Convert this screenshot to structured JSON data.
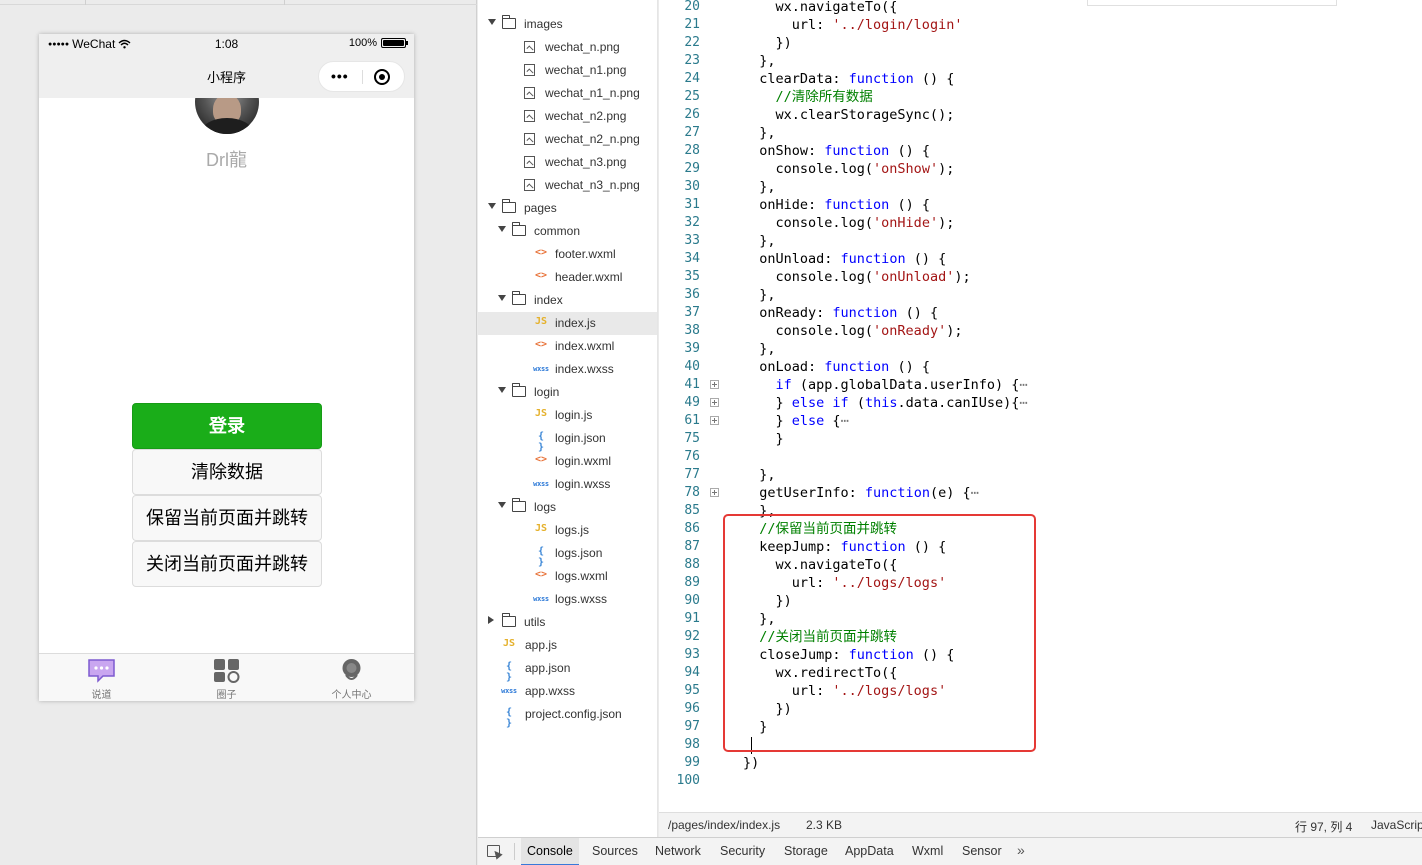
{
  "simulator": {
    "status_bar": {
      "carrier": "WeChat",
      "signal": "●●●●●",
      "time": "1:08",
      "battery": "100%"
    },
    "nav_bar": {
      "title": "小程序",
      "more": "•••"
    },
    "nickname": "Drl龍",
    "buttons": {
      "login": "登录",
      "clear": "清除数据",
      "keep_jump": "保留当前页面并跳转",
      "close_jump": "关闭当前页面并跳转"
    },
    "tabs": [
      {
        "label": "说道",
        "icon": "chat-icon",
        "color": "#1aad19"
      },
      {
        "label": "圈子",
        "icon": "circle-icon",
        "color": "#777777"
      },
      {
        "label": "个人中心",
        "icon": "profile-icon",
        "color": "#777777"
      }
    ]
  },
  "file_tree": {
    "items": [
      {
        "label": "images",
        "type": "folder",
        "expanded": true
      },
      {
        "label": "wechat_n.png",
        "type": "image"
      },
      {
        "label": "wechat_n1.png",
        "type": "image"
      },
      {
        "label": "wechat_n1_n.png",
        "type": "image"
      },
      {
        "label": "wechat_n2.png",
        "type": "image"
      },
      {
        "label": "wechat_n2_n.png",
        "type": "image"
      },
      {
        "label": "wechat_n3.png",
        "type": "image"
      },
      {
        "label": "wechat_n3_n.png",
        "type": "image"
      },
      {
        "label": "pages",
        "type": "folder",
        "expanded": true
      },
      {
        "label": "common",
        "type": "folder",
        "expanded": true
      },
      {
        "label": "footer.wxml",
        "type": "wxml"
      },
      {
        "label": "header.wxml",
        "type": "wxml"
      },
      {
        "label": "index",
        "type": "folder",
        "expanded": true
      },
      {
        "label": "index.js",
        "type": "js",
        "selected": true
      },
      {
        "label": "index.wxml",
        "type": "wxml"
      },
      {
        "label": "index.wxss",
        "type": "wxss"
      },
      {
        "label": "login",
        "type": "folder",
        "expanded": true
      },
      {
        "label": "login.js",
        "type": "js"
      },
      {
        "label": "login.json",
        "type": "json"
      },
      {
        "label": "login.wxml",
        "type": "wxml"
      },
      {
        "label": "login.wxss",
        "type": "wxss"
      },
      {
        "label": "logs",
        "type": "folder",
        "expanded": true
      },
      {
        "label": "logs.js",
        "type": "js"
      },
      {
        "label": "logs.json",
        "type": "json"
      },
      {
        "label": "logs.wxml",
        "type": "wxml"
      },
      {
        "label": "logs.wxss",
        "type": "wxss"
      },
      {
        "label": "utils",
        "type": "folder",
        "expanded": false
      },
      {
        "label": "app.js",
        "type": "js"
      },
      {
        "label": "app.json",
        "type": "json"
      },
      {
        "label": "app.wxss",
        "type": "wxss"
      },
      {
        "label": "project.config.json",
        "type": "json"
      }
    ],
    "icon_glyphs": {
      "js": "JS",
      "wxml": "<>",
      "json": "{ }",
      "wxss": "wxss"
    }
  },
  "editor": {
    "lines": [
      {
        "n": "20",
        "tokens": [
          [
            "    wx.navigateTo({",
            ""
          ]
        ]
      },
      {
        "n": "21",
        "tokens": [
          [
            "      url: ",
            ""
          ],
          [
            "'../login/login'",
            "str"
          ]
        ]
      },
      {
        "n": "22",
        "tokens": [
          [
            "    })",
            ""
          ]
        ]
      },
      {
        "n": "23",
        "tokens": [
          [
            "  },",
            ""
          ]
        ]
      },
      {
        "n": "24",
        "tokens": [
          [
            "  clearData: ",
            ""
          ],
          [
            "function",
            "kw"
          ],
          [
            " () {",
            ""
          ]
        ]
      },
      {
        "n": "25",
        "tokens": [
          [
            "    ",
            ""
          ],
          [
            "//清除所有数据",
            "cmt"
          ]
        ]
      },
      {
        "n": "26",
        "tokens": [
          [
            "    wx.clearStorageSync();",
            ""
          ]
        ]
      },
      {
        "n": "27",
        "tokens": [
          [
            "  },",
            ""
          ]
        ]
      },
      {
        "n": "28",
        "tokens": [
          [
            "  onShow: ",
            ""
          ],
          [
            "function",
            "kw"
          ],
          [
            " () {",
            ""
          ]
        ]
      },
      {
        "n": "29",
        "tokens": [
          [
            "    console.log(",
            ""
          ],
          [
            "'onShow'",
            "str"
          ],
          [
            ");",
            ""
          ]
        ]
      },
      {
        "n": "30",
        "tokens": [
          [
            "  },",
            ""
          ]
        ]
      },
      {
        "n": "31",
        "tokens": [
          [
            "  onHide: ",
            ""
          ],
          [
            "function",
            "kw"
          ],
          [
            " () {",
            ""
          ]
        ]
      },
      {
        "n": "32",
        "tokens": [
          [
            "    console.log(",
            ""
          ],
          [
            "'onHide'",
            "str"
          ],
          [
            ");",
            ""
          ]
        ]
      },
      {
        "n": "33",
        "tokens": [
          [
            "  },",
            ""
          ]
        ]
      },
      {
        "n": "34",
        "tokens": [
          [
            "  onUnload: ",
            ""
          ],
          [
            "function",
            "kw"
          ],
          [
            " () {",
            ""
          ]
        ]
      },
      {
        "n": "35",
        "tokens": [
          [
            "    console.log(",
            ""
          ],
          [
            "'onUnload'",
            "str"
          ],
          [
            ");",
            ""
          ]
        ]
      },
      {
        "n": "36",
        "tokens": [
          [
            "  },",
            ""
          ]
        ]
      },
      {
        "n": "37",
        "tokens": [
          [
            "  onReady: ",
            ""
          ],
          [
            "function",
            "kw"
          ],
          [
            " () {",
            ""
          ]
        ]
      },
      {
        "n": "38",
        "tokens": [
          [
            "    console.log(",
            ""
          ],
          [
            "'onReady'",
            "str"
          ],
          [
            ");",
            ""
          ]
        ]
      },
      {
        "n": "39",
        "tokens": [
          [
            "  },",
            ""
          ]
        ]
      },
      {
        "n": "40",
        "tokens": [
          [
            "  onLoad: ",
            ""
          ],
          [
            "function",
            "kw"
          ],
          [
            " () {",
            ""
          ]
        ]
      },
      {
        "n": "41",
        "fold": true,
        "tokens": [
          [
            "    ",
            ""
          ],
          [
            "if",
            "kw"
          ],
          [
            " (app.globalData.userInfo) {",
            ""
          ],
          [
            "⋯",
            "dim"
          ]
        ]
      },
      {
        "n": "49",
        "fold": true,
        "tokens": [
          [
            "    } ",
            ""
          ],
          [
            "else if",
            "kw"
          ],
          [
            " (",
            ""
          ],
          [
            "this",
            "kw"
          ],
          [
            ".data.canIUse){",
            ""
          ],
          [
            "⋯",
            "dim"
          ]
        ]
      },
      {
        "n": "61",
        "fold": true,
        "tokens": [
          [
            "    } ",
            ""
          ],
          [
            "else",
            "kw"
          ],
          [
            " {",
            ""
          ],
          [
            "⋯",
            "dim"
          ]
        ]
      },
      {
        "n": "75",
        "tokens": [
          [
            "    }",
            ""
          ]
        ]
      },
      {
        "n": "76",
        "tokens": [
          [
            "",
            ""
          ]
        ]
      },
      {
        "n": "77",
        "tokens": [
          [
            "  },",
            ""
          ]
        ]
      },
      {
        "n": "78",
        "fold": true,
        "tokens": [
          [
            "  getUserInfo: ",
            ""
          ],
          [
            "function",
            "kw"
          ],
          [
            "(e) {",
            ""
          ],
          [
            "⋯",
            "dim"
          ]
        ]
      },
      {
        "n": "85",
        "tokens": [
          [
            "  },",
            ""
          ]
        ]
      },
      {
        "n": "86",
        "tokens": [
          [
            "  ",
            ""
          ],
          [
            "//保留当前页面并跳转",
            "cmt"
          ]
        ]
      },
      {
        "n": "87",
        "tokens": [
          [
            "  keepJump: ",
            ""
          ],
          [
            "function",
            "kw"
          ],
          [
            " () {",
            ""
          ]
        ]
      },
      {
        "n": "88",
        "tokens": [
          [
            "    wx.navigateTo({",
            ""
          ]
        ]
      },
      {
        "n": "89",
        "tokens": [
          [
            "      url: ",
            ""
          ],
          [
            "'../logs/logs'",
            "str"
          ]
        ]
      },
      {
        "n": "90",
        "tokens": [
          [
            "    })",
            ""
          ]
        ]
      },
      {
        "n": "91",
        "tokens": [
          [
            "  },",
            ""
          ]
        ]
      },
      {
        "n": "92",
        "tokens": [
          [
            "  ",
            ""
          ],
          [
            "//关闭当前页面并跳转",
            "cmt"
          ]
        ]
      },
      {
        "n": "93",
        "tokens": [
          [
            "  closeJump: ",
            ""
          ],
          [
            "function",
            "kw"
          ],
          [
            " () {",
            ""
          ]
        ]
      },
      {
        "n": "94",
        "tokens": [
          [
            "    wx.redirectTo({",
            ""
          ]
        ]
      },
      {
        "n": "95",
        "tokens": [
          [
            "      url: ",
            ""
          ],
          [
            "'../logs/logs'",
            "str"
          ]
        ]
      },
      {
        "n": "96",
        "tokens": [
          [
            "    })",
            ""
          ]
        ]
      },
      {
        "n": "97",
        "tokens": [
          [
            "  }",
            ""
          ]
        ]
      },
      {
        "n": "98",
        "tokens": [
          [
            "",
            ""
          ]
        ]
      },
      {
        "n": "99",
        "tokens": [
          [
            "})",
            ""
          ]
        ]
      },
      {
        "n": "100",
        "tokens": [
          [
            "",
            ""
          ]
        ]
      }
    ]
  },
  "editor_status": {
    "file_path": "/pages/index/index.js",
    "file_size": "2.3 KB",
    "cursor": "行 97, 列 4",
    "language": "JavaScript"
  },
  "devtools": {
    "tabs": [
      "Console",
      "Sources",
      "Network",
      "Security",
      "Storage",
      "AppData",
      "Wxml",
      "Sensor"
    ],
    "active_tab": "Console",
    "more": "»"
  },
  "colors": {
    "wechat_green": "#1aad19",
    "highlight_red": "#e53935",
    "devtools_active": "#3879d9"
  }
}
